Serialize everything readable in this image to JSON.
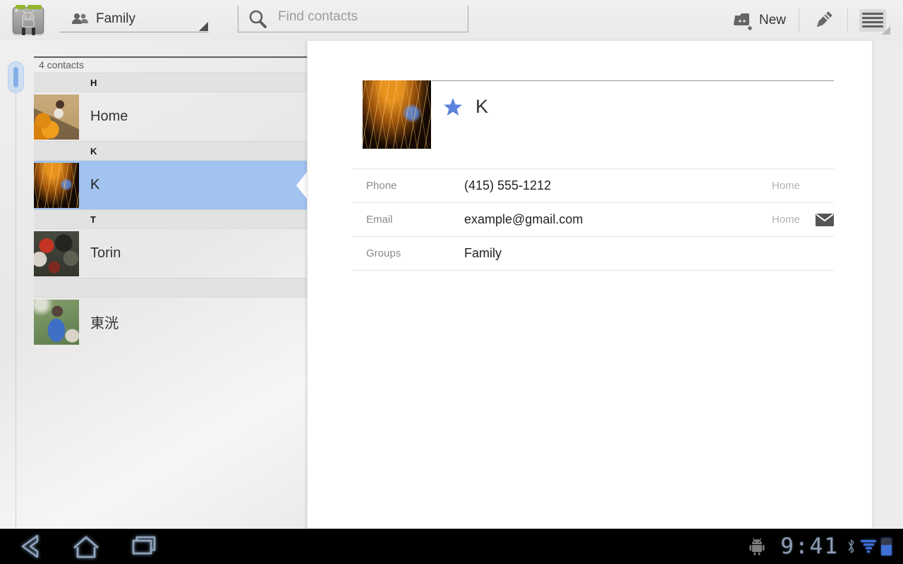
{
  "colors": {
    "selection_blue": "#a2c3f0",
    "star_blue": "#5b82dd",
    "status_blue": "#3f6fd5",
    "action_bar_bg": "#eeeeee"
  },
  "action_bar": {
    "group_selector": {
      "label": "Family",
      "icon": "group-icon"
    },
    "search": {
      "placeholder": "Find contacts",
      "icon": "search-icon"
    },
    "new_button": {
      "label": "New",
      "icon": "add-contact-icon"
    },
    "edit_button": {
      "icon": "pencil-icon"
    },
    "menu_button": {
      "icon": "menu-icon"
    }
  },
  "contact_list": {
    "count_label": "4 contacts",
    "sections": [
      {
        "letter": "H",
        "contacts": [
          {
            "name": "Home",
            "selected": false,
            "photo": "pumpkin-patch"
          }
        ]
      },
      {
        "letter": "K",
        "contacts": [
          {
            "name": "K",
            "selected": true,
            "photo": "fireworks"
          }
        ]
      },
      {
        "letter": "T",
        "contacts": [
          {
            "name": "Torin",
            "selected": false,
            "photo": "football-game"
          }
        ]
      },
      {
        "letter": "",
        "contacts": [
          {
            "name": "東洸",
            "selected": false,
            "photo": "child-life-vest"
          }
        ]
      }
    ]
  },
  "detail": {
    "name": "K",
    "starred": true,
    "photo": "fireworks",
    "fields": [
      {
        "label": "Phone",
        "value": "(415) 555-1212",
        "type": "Home",
        "action_icon": ""
      },
      {
        "label": "Email",
        "value": "example@gmail.com",
        "type": "Home",
        "action_icon": "email-icon"
      },
      {
        "label": "Groups",
        "value": "Family",
        "type": "",
        "action_icon": ""
      }
    ]
  },
  "system_bar": {
    "time": "9:41",
    "nav_icons": [
      "back-icon",
      "home-icon",
      "recents-icon"
    ],
    "status_icons": [
      "android-robot-icon",
      "bluetooth-icon",
      "wifi-icon",
      "battery-icon"
    ]
  }
}
